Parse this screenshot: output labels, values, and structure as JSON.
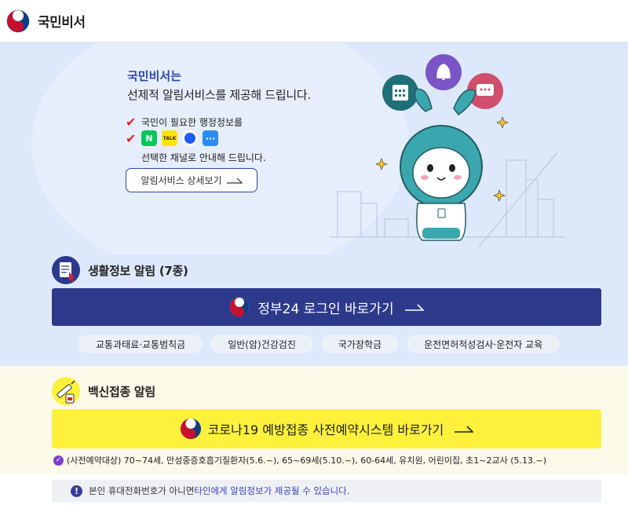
{
  "header": {
    "brand": "국민비서"
  },
  "hero": {
    "title": "국민비서는",
    "subtitle": "선제적 알림서비스를 제공해 드립니다.",
    "check1": "국민이 필요한 행정정보를",
    "channel_icons": [
      "naver-icon",
      "kakaotalk-icon",
      "toss-icon",
      "message-icon"
    ],
    "guide": "선택한 채널로 안내해 드립니다.",
    "detail_button": "알림서비스 상세보기"
  },
  "life": {
    "title": "생활정보 알림 (7종)",
    "login_button": "정부24 로그인 바로가기",
    "chips": [
      "교통과태료·교통범칙금",
      "일반(암)건강검진",
      "국가장학금",
      "운전면허적성검사·운전자 교육"
    ]
  },
  "vaccine": {
    "title": "백신접종 알림",
    "button": "코로나19 예방접종 사전예약시스템 바로가기",
    "note": "(사전예약대상) 70~74세, 만성중증호흡기질환자(5.6.~), 65~69세(5.10.~), 60-64세, 유치원, 어린이집, 초1~2교사 (5.13.~)"
  },
  "notice": {
    "prefix": "본인 휴대전화번호가 아니면 ",
    "highlight": "타인에게 알림정보가 제공될 수 있습니다."
  },
  "colors": {
    "brand_blue": "#2d46a8",
    "gov_button": "#2d3a8c",
    "vaccine_button": "#fdf13b",
    "hero_bg": "#dde8fb",
    "vaccine_bg": "#fbf9e8"
  }
}
